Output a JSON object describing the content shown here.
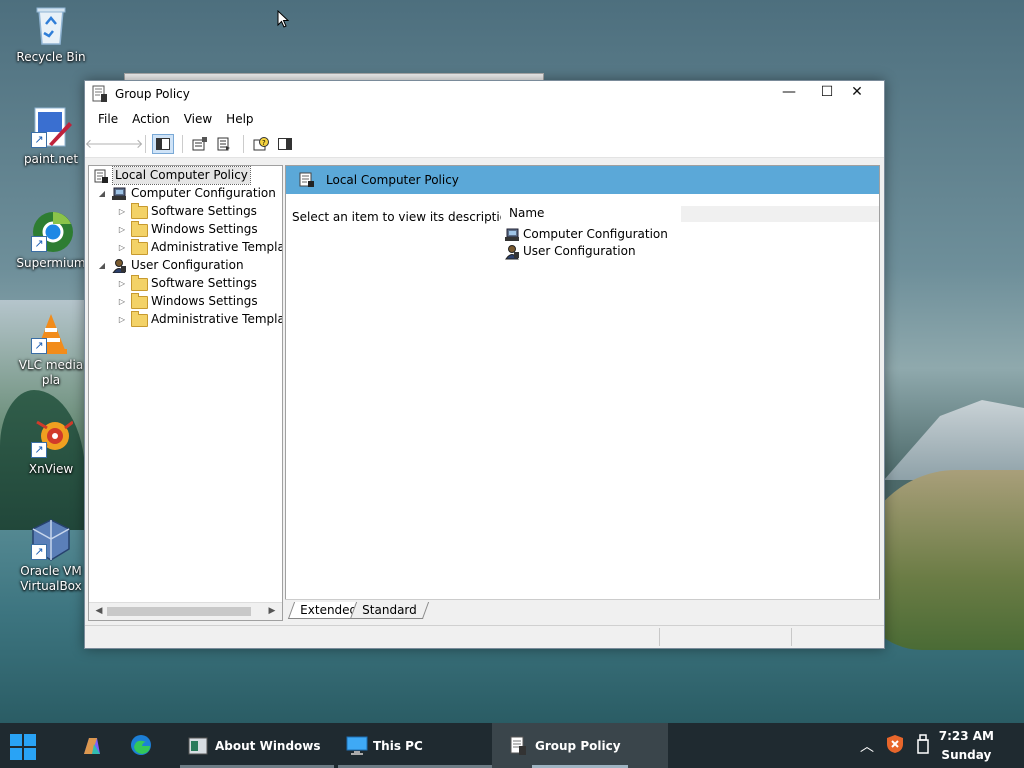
{
  "desktop": {
    "icons": [
      {
        "label": "Recycle Bin"
      },
      {
        "label": "paint.net"
      },
      {
        "label": "Supermium"
      },
      {
        "label": "VLC media pla"
      },
      {
        "label": "XnView"
      },
      {
        "label": "Oracle VM VirtualBox"
      }
    ]
  },
  "window": {
    "title": "Group Policy",
    "controls": {
      "minimize": "—",
      "maximize": "☐",
      "close": "✕"
    },
    "menu": [
      "File",
      "Action",
      "View",
      "Help"
    ],
    "toolbar": {
      "icons": [
        "back-arrow-icon",
        "forward-arrow-icon",
        "show-hide-tree-icon",
        "properties-icon",
        "export-list-icon",
        "help-icon",
        "action-pane-icon"
      ]
    },
    "tree": {
      "root": "Local Computer Policy",
      "computer_configuration": {
        "label": "Computer Configuration",
        "children": [
          "Software Settings",
          "Windows Settings",
          "Administrative Template"
        ]
      },
      "user_configuration": {
        "label": "User Configuration",
        "children": [
          "Software Settings",
          "Windows Settings",
          "Administrative Template"
        ]
      }
    },
    "result": {
      "header": "Local Computer Policy",
      "description": "Select an item to view its description.",
      "column_name": "Name",
      "items": [
        "Computer Configuration",
        "User Configuration"
      ]
    },
    "tabs": [
      "Extended",
      "Standard"
    ]
  },
  "taskbar": {
    "apps": [
      {
        "label": "About Windows"
      },
      {
        "label": "This PC"
      },
      {
        "label": "Group Policy"
      }
    ],
    "clock": {
      "time": "7:23 AM",
      "day": "Sunday"
    },
    "tray_icons": [
      "chevron-up-icon",
      "security-shield-icon",
      "usb-drive-icon"
    ]
  }
}
